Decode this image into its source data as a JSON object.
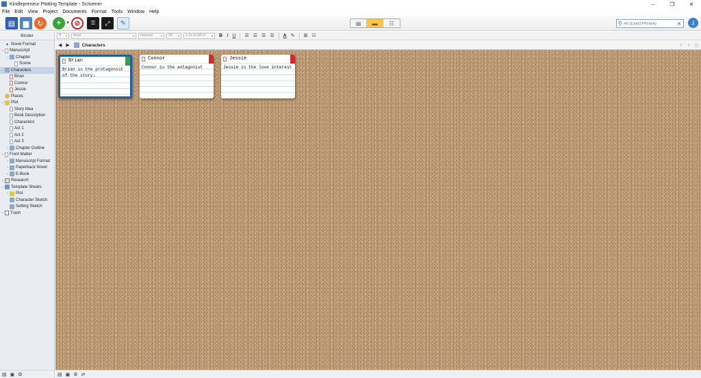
{
  "window": {
    "title": "Kindlepreneur Plotting Template - Scrivener",
    "controls": [
      "–",
      "❐",
      "✕"
    ]
  },
  "menu": [
    "File",
    "Edit",
    "View",
    "Project",
    "Documents",
    "Format",
    "Tools",
    "Window",
    "Help"
  ],
  "search": {
    "placeholder": "All (Exact Phrase)"
  },
  "binder": {
    "title": "Binder",
    "items": [
      {
        "label": "Novel Format",
        "depth": 0,
        "icon": "draft",
        "disclosure": ""
      },
      {
        "label": "Manuscript",
        "depth": 0,
        "icon": "doc",
        "disclosure": "v"
      },
      {
        "label": "Chapter",
        "depth": 1,
        "icon": "folder",
        "disclosure": "v"
      },
      {
        "label": "Scene",
        "depth": 2,
        "icon": "doc",
        "disclosure": ""
      },
      {
        "label": "Characters",
        "depth": 0,
        "icon": "folder",
        "disclosure": "v",
        "selected": true
      },
      {
        "label": "Brian",
        "depth": 1,
        "icon": "char",
        "disclosure": ""
      },
      {
        "label": "Connor",
        "depth": 1,
        "icon": "char",
        "disclosure": ""
      },
      {
        "label": "Jessie",
        "depth": 1,
        "icon": "char",
        "disclosure": ""
      },
      {
        "label": "Places",
        "depth": 0,
        "icon": "places",
        "disclosure": ""
      },
      {
        "label": "Plot",
        "depth": 0,
        "icon": "plot",
        "disclosure": "v"
      },
      {
        "label": "Story Idea",
        "depth": 1,
        "icon": "doc",
        "disclosure": ""
      },
      {
        "label": "Book Description",
        "depth": 1,
        "icon": "doc",
        "disclosure": ""
      },
      {
        "label": "Characters",
        "depth": 1,
        "icon": "doc",
        "disclosure": ""
      },
      {
        "label": "Act 1",
        "depth": 1,
        "icon": "doc",
        "disclosure": ""
      },
      {
        "label": "Act 2",
        "depth": 1,
        "icon": "doc",
        "disclosure": ""
      },
      {
        "label": "Act 3",
        "depth": 1,
        "icon": "doc",
        "disclosure": ""
      },
      {
        "label": "Chapter Outline",
        "depth": 1,
        "icon": "folder",
        "disclosure": ">"
      },
      {
        "label": "Front Matter",
        "depth": 0,
        "icon": "doc",
        "disclosure": "v"
      },
      {
        "label": "Manuscript Format",
        "depth": 1,
        "icon": "folder",
        "disclosure": ">"
      },
      {
        "label": "Paperback Novel",
        "depth": 1,
        "icon": "folder",
        "disclosure": ">"
      },
      {
        "label": "E-Book",
        "depth": 1,
        "icon": "folder",
        "disclosure": ">"
      },
      {
        "label": "Research",
        "depth": 0,
        "icon": "research",
        "disclosure": ">"
      },
      {
        "label": "Template Sheets",
        "depth": 0,
        "icon": "template",
        "disclosure": "v"
      },
      {
        "label": "Plot",
        "depth": 1,
        "icon": "plot",
        "disclosure": ">"
      },
      {
        "label": "Character Sketch",
        "depth": 1,
        "icon": "folder",
        "disclosure": ""
      },
      {
        "label": "Setting Sketch",
        "depth": 1,
        "icon": "folder",
        "disclosure": ""
      },
      {
        "label": "Trash",
        "depth": 0,
        "icon": "trash",
        "disclosure": ">"
      }
    ]
  },
  "formatbar": {
    "paragraph_style": "¶",
    "font": "Arial",
    "typeface": "Normal",
    "size": "20",
    "spacing": "1.2x 8.0/0.0",
    "bold": "B",
    "italic": "I",
    "underline": "U"
  },
  "editor": {
    "header_title": "Characters",
    "cards": [
      {
        "title": "Brian",
        "synopsis": "Brian is the protagonist of the story.",
        "label_color": "#3aa33a",
        "selected": true
      },
      {
        "title": "Connor",
        "synopsis": "Connor is the antagonist",
        "label_color": "#d22a2a",
        "selected": false
      },
      {
        "title": "Jessie",
        "synopsis": "Jessie is the love interest",
        "label_color": "#d22a2a",
        "selected": false
      }
    ]
  },
  "colors": {
    "accent": "#2e63b8",
    "selection_border": "#1d5fa8",
    "corkboard": "#c19e7a",
    "view_active": "#f7c64a"
  }
}
